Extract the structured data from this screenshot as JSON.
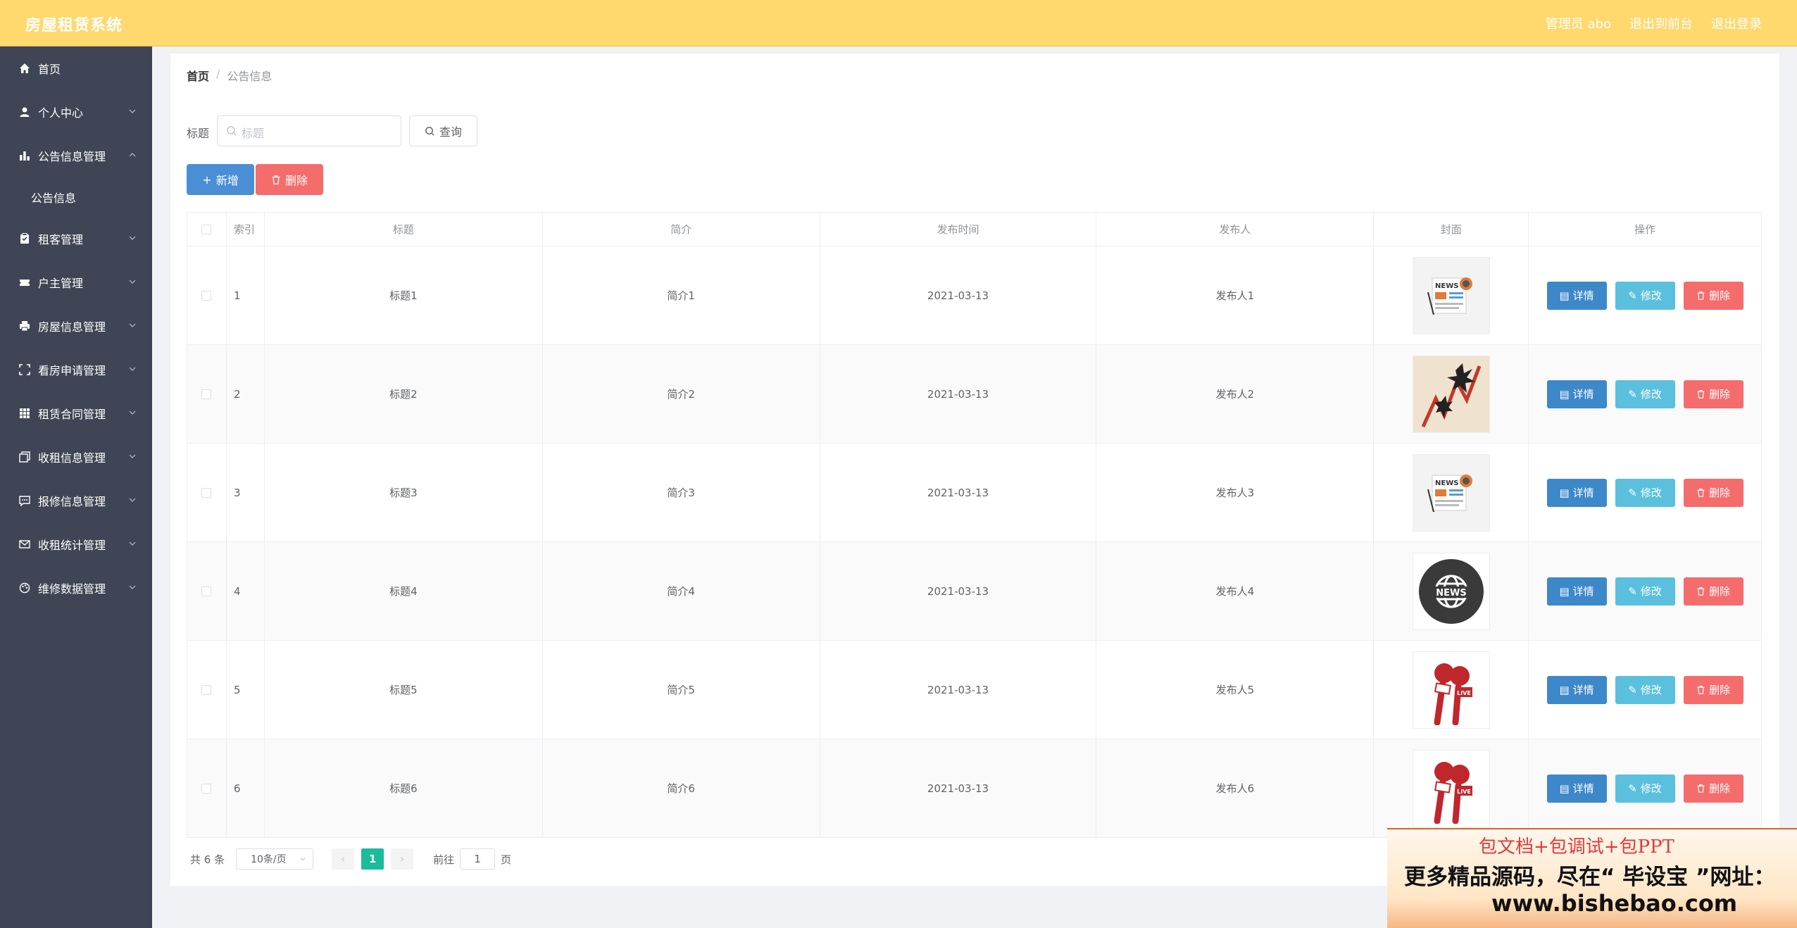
{
  "header": {
    "app_title": "房屋租赁系统",
    "admin_label": "管理员 abo",
    "goto_front": "退出到前台",
    "logout": "退出登录"
  },
  "sidebar": {
    "items": [
      {
        "label": "首页",
        "icon": "home-icon"
      },
      {
        "label": "个人中心",
        "icon": "user-icon"
      },
      {
        "label": "公告信息管理",
        "icon": "bar-chart-icon",
        "expanded": true
      },
      {
        "label": "租客管理",
        "icon": "clipboard-icon"
      },
      {
        "label": "户主管理",
        "icon": "ticket-icon"
      },
      {
        "label": "房屋信息管理",
        "icon": "printer-icon"
      },
      {
        "label": "看房申请管理",
        "icon": "fullscreen-icon"
      },
      {
        "label": "租赁合同管理",
        "icon": "grid-icon"
      },
      {
        "label": "收租信息管理",
        "icon": "copy-icon"
      },
      {
        "label": "报修信息管理",
        "icon": "chat-icon"
      },
      {
        "label": "收租统计管理",
        "icon": "mail-icon"
      },
      {
        "label": "维修数据管理",
        "icon": "palette-icon"
      }
    ],
    "active_sub": "公告信息"
  },
  "breadcrumb": {
    "home": "首页",
    "sep": "/",
    "current": "公告信息"
  },
  "search": {
    "label": "标题",
    "placeholder": "标题",
    "query_button": "查询"
  },
  "actions": {
    "add": "新增",
    "delete": "删除"
  },
  "table": {
    "headers": [
      "索引",
      "标题",
      "简介",
      "发布时间",
      "发布人",
      "封面",
      "操作"
    ],
    "rows": [
      {
        "index": "1",
        "title": "标题1",
        "intro": "简介1",
        "time": "2021-03-13",
        "author": "发布人1",
        "cover": "news-paper"
      },
      {
        "index": "2",
        "title": "标题2",
        "intro": "简介2",
        "time": "2021-03-13",
        "author": "发布人2",
        "cover": "news-chart"
      },
      {
        "index": "3",
        "title": "标题3",
        "intro": "简介3",
        "time": "2021-03-13",
        "author": "发布人3",
        "cover": "news-paper"
      },
      {
        "index": "4",
        "title": "标题4",
        "intro": "简介4",
        "time": "2021-03-13",
        "author": "发布人4",
        "cover": "news-globe"
      },
      {
        "index": "5",
        "title": "标题5",
        "intro": "简介5",
        "time": "2021-03-13",
        "author": "发布人5",
        "cover": "news-mic"
      },
      {
        "index": "6",
        "title": "标题6",
        "intro": "简介6",
        "time": "2021-03-13",
        "author": "发布人6",
        "cover": "news-mic"
      }
    ],
    "op_labels": {
      "detail": "详情",
      "edit": "修改",
      "remove": "删除"
    }
  },
  "pagination": {
    "total": "共 6 条",
    "page_size": "10条/页",
    "current_page": "1",
    "goto_prefix": "前往",
    "goto_value": "1",
    "goto_suffix": "页"
  },
  "banner": {
    "line1": "包文档+包调试+包PPT",
    "line2": "更多精品源码，尽在“ 毕设宝 ”网址：",
    "line3": "www.bishebao.com"
  },
  "colors": {
    "header_bg": "#ffd86e",
    "sidebar_bg": "#3f4554",
    "primary": "#4a8fd6",
    "danger": "#f56c6c",
    "info": "#5bc0de",
    "page_active": "#1abc9c"
  }
}
